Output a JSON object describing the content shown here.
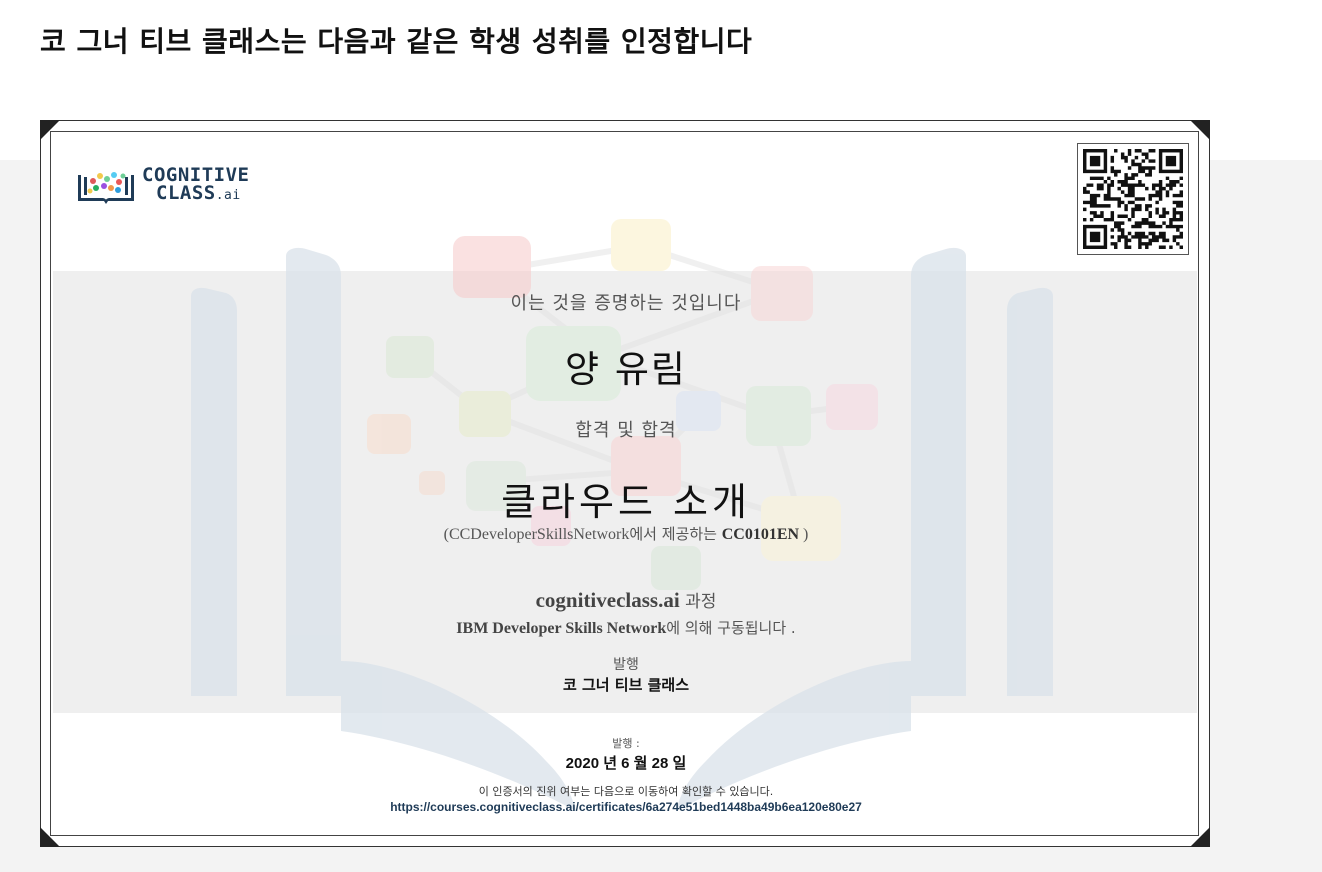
{
  "page": {
    "heading": "코 그너 티브 클래스는 다음과 같은 학생 성취를 인정합니다"
  },
  "certificate": {
    "logo": {
      "line1": "COGNITIVE",
      "line2": "CLASS",
      "line2_suffix": ".ai"
    },
    "certify_text": "이는 것을 증명하는 것입니다",
    "recipient_name": "양 유림",
    "passed_text": "합격 및 합격",
    "course_title": "클라우드 소개",
    "offered_by": {
      "prefix": "(CCDeveloperSkillsNetwork",
      "middle": "에서 제공하는 ",
      "code": "CC0101EN",
      "suffix": " )"
    },
    "via": {
      "site": "cognitiveclass.ai",
      "suffix": " 과정"
    },
    "powered_by": {
      "org": "IBM Developer Skills Network",
      "suffix": "에 의해 구동됩니다 ."
    },
    "issued_by_label": "발행",
    "issuer": "코 그너 티브 클래스",
    "issued_label": "발행 :",
    "issue_date": "2020 년 6 월 28 일",
    "verify_text": "이 인증서의 진위 여부는 다음으로 이동하여 확인할 수 있습니다.",
    "verify_url": "https://courses.cognitiveclass.ai/certificates/6a274e51bed1448ba49b6ea120e80e27"
  },
  "colors": {
    "brand_navy": "#1f3b57",
    "page_bg": "#f3f3f3",
    "corner": "#222222"
  }
}
